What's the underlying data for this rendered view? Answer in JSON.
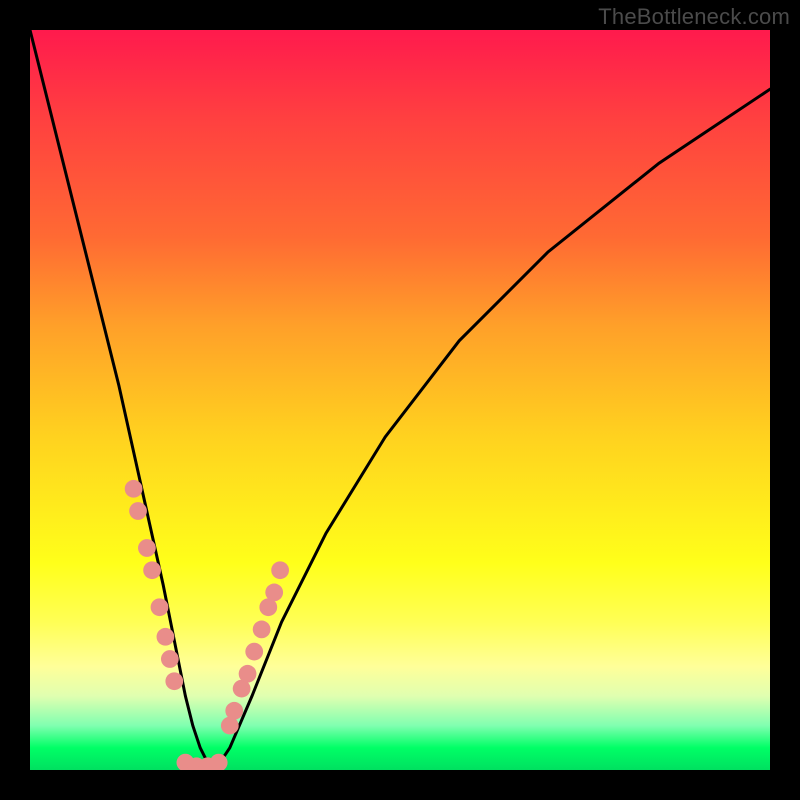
{
  "watermark": "TheBottleneck.com",
  "chart_data": {
    "type": "line",
    "title": "",
    "xlabel": "",
    "ylabel": "",
    "xlim": [
      0,
      100
    ],
    "ylim": [
      0,
      100
    ],
    "series": [
      {
        "name": "bottleneck-curve",
        "x": [
          0,
          3,
          6,
          9,
          12,
          14,
          16,
          18,
          19,
          20,
          21,
          22,
          23,
          24,
          25,
          27,
          30,
          34,
          40,
          48,
          58,
          70,
          85,
          100
        ],
        "values": [
          100,
          88,
          76,
          64,
          52,
          43,
          34,
          25,
          20,
          15,
          10,
          6,
          3,
          1,
          0,
          3,
          10,
          20,
          32,
          45,
          58,
          70,
          82,
          92
        ]
      }
    ],
    "markers_left": {
      "name": "left-falling-markers",
      "x": [
        14.0,
        14.6,
        15.8,
        16.5,
        17.5,
        18.3,
        18.9,
        19.5
      ],
      "values": [
        38,
        35,
        30,
        27,
        22,
        18,
        15,
        12
      ]
    },
    "markers_right": {
      "name": "right-rising-markers",
      "x": [
        27.0,
        27.6,
        28.6,
        29.4,
        30.3,
        31.3,
        32.2,
        33.0,
        33.8
      ],
      "values": [
        6,
        8,
        11,
        13,
        16,
        19,
        22,
        24,
        27
      ]
    },
    "markers_bottom": {
      "name": "trough-markers",
      "x": [
        21.0,
        22.5,
        24.0,
        25.5
      ],
      "values": [
        1.0,
        0.5,
        0.5,
        1.0
      ]
    },
    "marker_style": {
      "color": "#e98d8a",
      "radius_pct": 1.2
    },
    "background_gradient": {
      "top": "#ff1a4d",
      "mid": "#ffff1a",
      "bottom": "#00e060"
    }
  }
}
